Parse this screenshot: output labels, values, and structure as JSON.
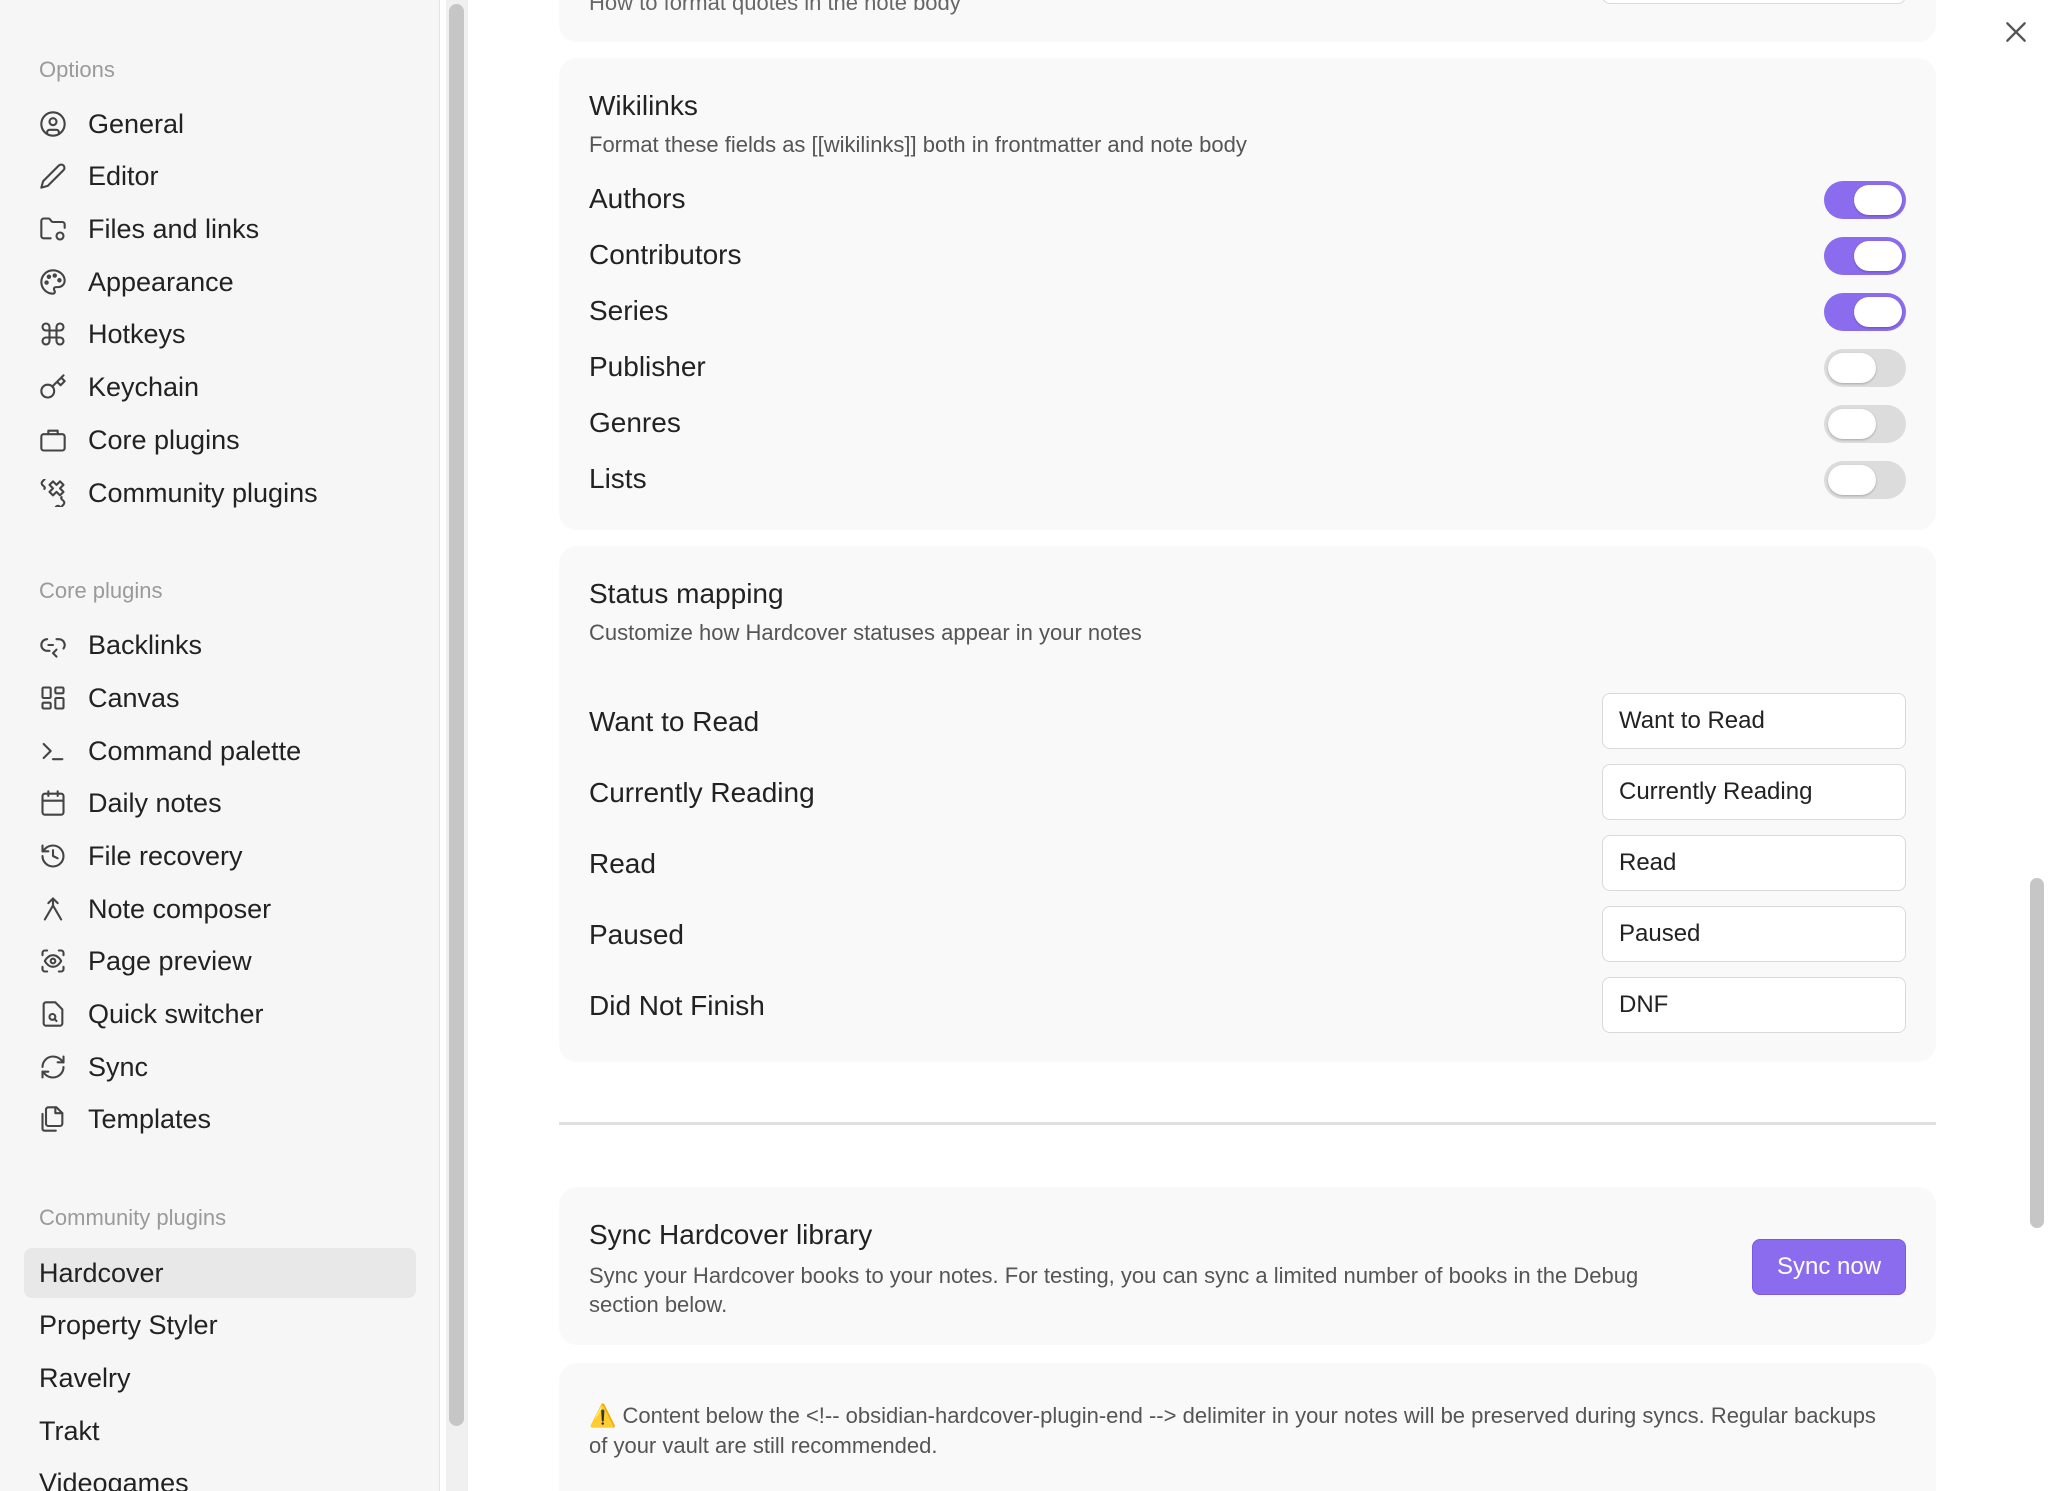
{
  "sidebar": {
    "options_title": "Options",
    "options": [
      {
        "label": "General",
        "icon": "user-circle-icon"
      },
      {
        "label": "Editor",
        "icon": "pencil-icon"
      },
      {
        "label": "Files and links",
        "icon": "folder-cog-icon"
      },
      {
        "label": "Appearance",
        "icon": "palette-icon"
      },
      {
        "label": "Hotkeys",
        "icon": "command-icon"
      },
      {
        "label": "Keychain",
        "icon": "key-icon"
      },
      {
        "label": "Core plugins",
        "icon": "briefcase-icon"
      },
      {
        "label": "Community plugins",
        "icon": "puzzle-icon"
      }
    ],
    "core_title": "Core plugins",
    "core": [
      {
        "label": "Backlinks",
        "icon": "backlinks-icon"
      },
      {
        "label": "Canvas",
        "icon": "layout-dashboard-icon"
      },
      {
        "label": "Command palette",
        "icon": "terminal-icon"
      },
      {
        "label": "Daily notes",
        "icon": "calendar-icon"
      },
      {
        "label": "File recovery",
        "icon": "history-icon"
      },
      {
        "label": "Note composer",
        "icon": "merge-icon"
      },
      {
        "label": "Page preview",
        "icon": "scan-eye-icon"
      },
      {
        "label": "Quick switcher",
        "icon": "file-search-icon"
      },
      {
        "label": "Sync",
        "icon": "refresh-icon"
      },
      {
        "label": "Templates",
        "icon": "files-icon"
      }
    ],
    "community_title": "Community plugins",
    "community": [
      {
        "label": "Hardcover",
        "active": true
      },
      {
        "label": "Property Styler"
      },
      {
        "label": "Ravelry"
      },
      {
        "label": "Trakt"
      },
      {
        "label": "Videogames"
      }
    ]
  },
  "top_fragment": "How to format quotes in the note body",
  "wikilinks": {
    "title": "Wikilinks",
    "description": "Format these fields as [[wikilinks]] both in frontmatter and note body",
    "fields": [
      {
        "label": "Authors",
        "enabled": true
      },
      {
        "label": "Contributors",
        "enabled": true
      },
      {
        "label": "Series",
        "enabled": true
      },
      {
        "label": "Publisher",
        "enabled": false
      },
      {
        "label": "Genres",
        "enabled": false
      },
      {
        "label": "Lists",
        "enabled": false
      }
    ]
  },
  "status_mapping": {
    "title": "Status mapping",
    "description": "Customize how Hardcover statuses appear in your notes",
    "rows": [
      {
        "label": "Want to Read",
        "value": "Want to Read"
      },
      {
        "label": "Currently Reading",
        "value": "Currently Reading"
      },
      {
        "label": "Read",
        "value": "Read"
      },
      {
        "label": "Paused",
        "value": "Paused"
      },
      {
        "label": "Did Not Finish",
        "value": "DNF"
      }
    ]
  },
  "sync": {
    "title": "Sync Hardcover library",
    "description": "Sync your Hardcover books to your notes. For testing, you can sync a limited number of books in the Debug section below.",
    "button_label": "Sync now"
  },
  "notice": {
    "icon": "warning-icon",
    "text": "⚠️ Content below the <!-- obsidian-hardcover-plugin-end --> delimiter in your notes will be preserved during syncs. Regular backups of your vault are still recommended."
  },
  "colors": {
    "accent": "#8b6cef",
    "toggle_off": "#dcdcdc"
  }
}
